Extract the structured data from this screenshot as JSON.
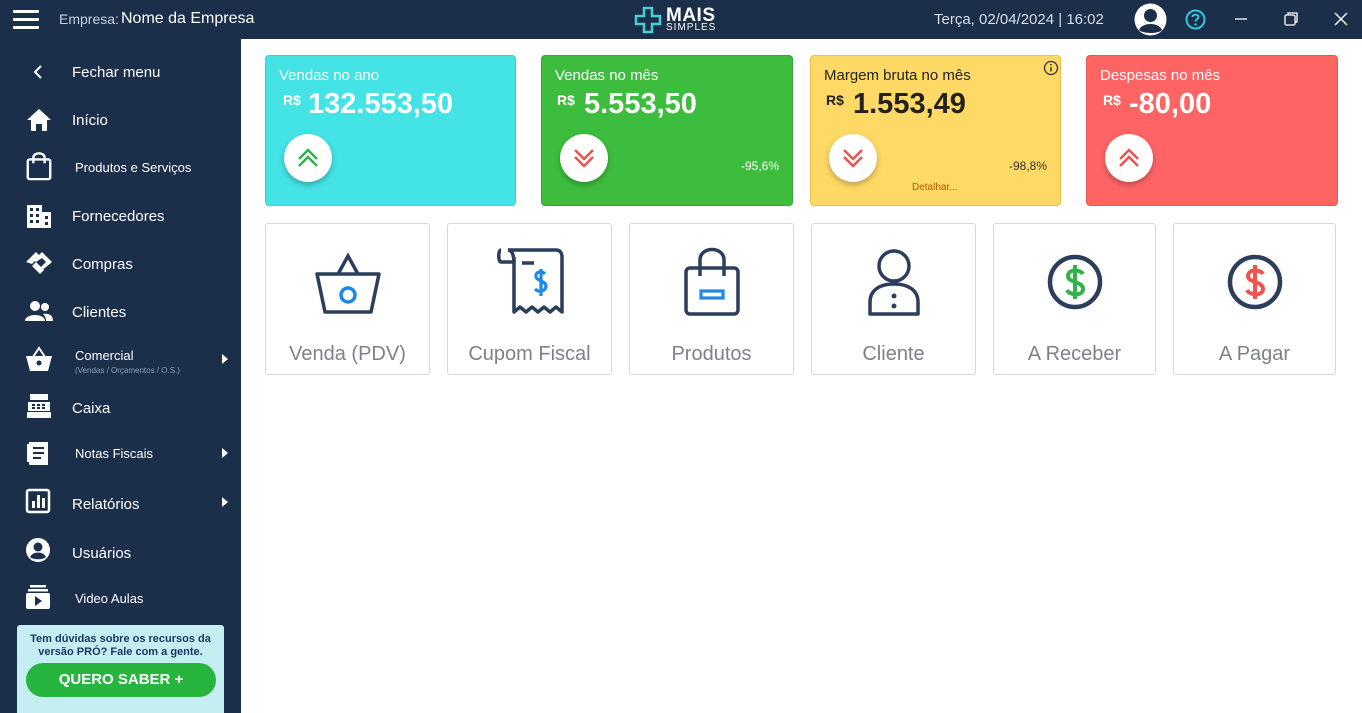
{
  "topbar": {
    "company_label": "Empresa:",
    "company_name": "Nome da Empresa",
    "logo_line1": "MAIS",
    "logo_line2": "SIMPLES",
    "datetime": "Terça, 02/04/2024 | 16:02",
    "icons": [
      "menu-icon",
      "user-avatar-icon",
      "help-icon",
      "minimize-icon",
      "restore-icon",
      "close-icon"
    ]
  },
  "sidebar": {
    "items": [
      {
        "label": "Fechar menu",
        "icon": "chevron-left-icon"
      },
      {
        "label": "Início",
        "icon": "home-icon"
      },
      {
        "label": "Produtos e Serviços",
        "icon": "shopping-bag-icon"
      },
      {
        "label": "Fornecedores",
        "icon": "building-icon"
      },
      {
        "label": "Compras",
        "icon": "handshake-icon"
      },
      {
        "label": "Clientes",
        "icon": "people-icon"
      },
      {
        "label": "Comercial",
        "sub": "(Vendas / Orçamentos / O.S.)",
        "icon": "basket-icon"
      },
      {
        "label": "Caixa",
        "icon": "cash-register-icon"
      },
      {
        "label": "Notas Fiscais",
        "icon": "invoice-icon"
      },
      {
        "label": "Relatórios",
        "icon": "bar-chart-icon"
      },
      {
        "label": "Usuários",
        "icon": "account-circle-icon"
      },
      {
        "label": "Video Aulas",
        "icon": "video-library-icon"
      }
    ],
    "promo": {
      "text": "Tem dúvidas sobre os recursos da versão PRÓ? Fale com a gente.",
      "button": "QUERO SABER +"
    }
  },
  "cards": [
    {
      "title": "Vendas no ano",
      "currency": "R$",
      "value": "132.553,50",
      "trend": "up",
      "color": "#44e3e5"
    },
    {
      "title": "Vendas no mês",
      "currency": "R$",
      "value": "5.553,50",
      "trend": "down",
      "pct": "-95,6%",
      "color": "#3dbd3d"
    },
    {
      "title": "Margem bruta no mês",
      "currency": "R$",
      "value": "1.553,49",
      "trend": "down",
      "pct": "-98,8%",
      "link": "Detalhar...",
      "color": "#ffd966"
    },
    {
      "title": "Despesas no mês",
      "currency": "R$",
      "value": "-80,00",
      "trend": "up",
      "color": "#ff6464"
    }
  ],
  "shortcuts": [
    {
      "label": "Venda (PDV)",
      "icon": "basket-icon"
    },
    {
      "label": "Cupom Fiscal",
      "icon": "receipt-icon"
    },
    {
      "label": "Produtos",
      "icon": "shopping-bag-icon"
    },
    {
      "label": "Cliente",
      "icon": "person-icon"
    },
    {
      "label": "A Receber",
      "icon": "dollar-in-icon"
    },
    {
      "label": "A Pagar",
      "icon": "dollar-out-icon"
    }
  ]
}
